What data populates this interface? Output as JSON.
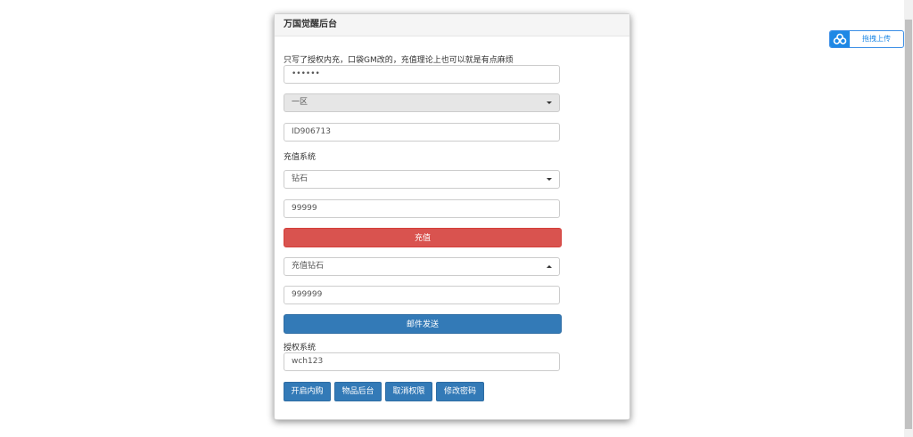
{
  "panel": {
    "title": "万国觉醒后台",
    "notice": "只写了授权内充，口袋GM改的，充值理论上也可以就是有点麻烦",
    "password_value": "••••••",
    "server_select": "一区",
    "player_id": "ID906713",
    "recharge_label": "充值系统",
    "recharge_item": "钻石",
    "recharge_amount": "99999",
    "recharge_button": "充值",
    "mail_item": "充值钻石",
    "mail_amount": "999999",
    "mail_button": "邮件发送",
    "auth_label": "授权系统",
    "auth_value": "wch123",
    "buttons": [
      "开启内购",
      "物品后台",
      "取消权限",
      "修改密码"
    ]
  },
  "upload_widget": {
    "label": "拖拽上传"
  },
  "colors": {
    "danger": "#d9534f",
    "primary": "#337ab7",
    "upload_accent": "#1e88e5"
  },
  "icons": {
    "select_caret": "caret-down-icon",
    "select_caret_open": "caret-up-icon",
    "upload": "cloud-upload-icon"
  }
}
